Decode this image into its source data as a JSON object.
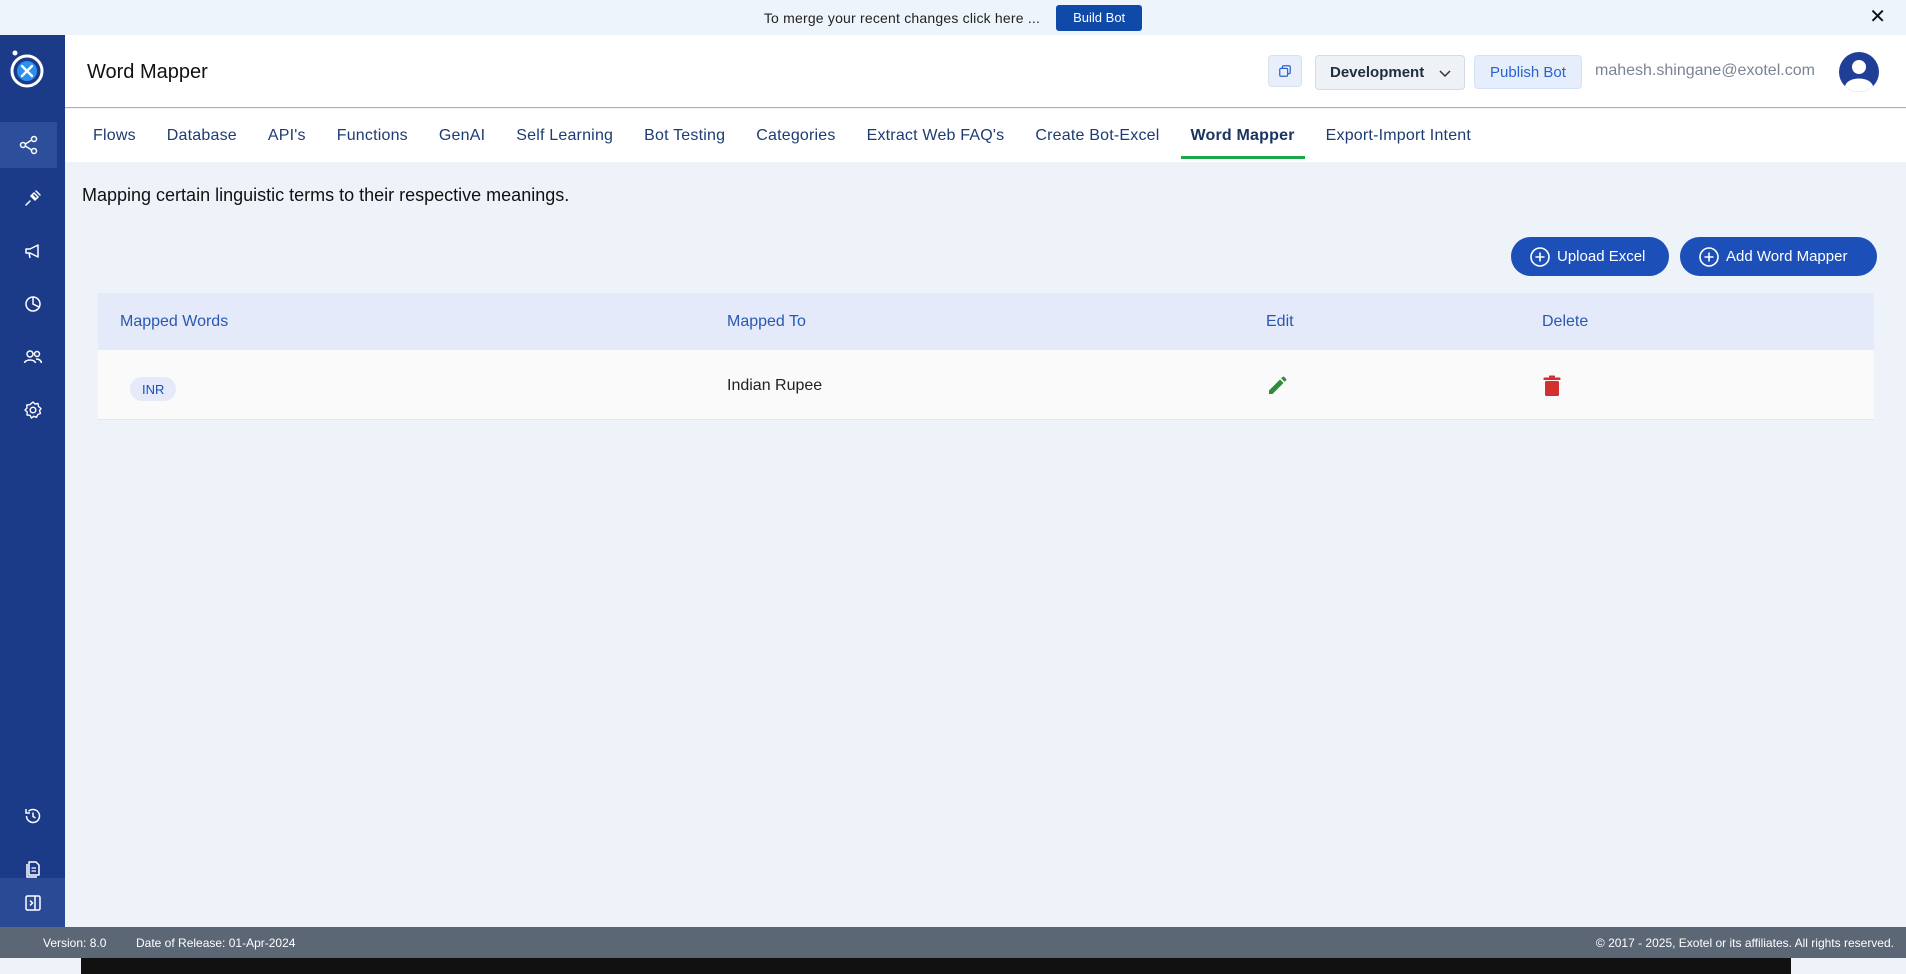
{
  "banner": {
    "message": "To merge your recent changes click here ...",
    "build_label": "Build Bot"
  },
  "sidebar": {
    "items": [
      {
        "icon": "flow-icon"
      },
      {
        "icon": "plug-icon"
      },
      {
        "icon": "megaphone-icon"
      },
      {
        "icon": "analytics-icon"
      },
      {
        "icon": "users-icon"
      },
      {
        "icon": "settings-icon"
      },
      {
        "icon": "history-icon"
      },
      {
        "icon": "documents-icon"
      },
      {
        "icon": "collapse-icon"
      }
    ]
  },
  "header": {
    "title": "Word Mapper",
    "environment": "Development",
    "publish_label": "Publish Bot",
    "user_email": "mahesh.shingane@exotel.com"
  },
  "tabs": [
    {
      "label": "Flows"
    },
    {
      "label": "Database"
    },
    {
      "label": "API's"
    },
    {
      "label": "Functions"
    },
    {
      "label": "GenAI"
    },
    {
      "label": "Self Learning"
    },
    {
      "label": "Bot Testing"
    },
    {
      "label": "Categories"
    },
    {
      "label": "Extract Web FAQ's"
    },
    {
      "label": "Create Bot-Excel"
    },
    {
      "label": "Word Mapper",
      "active": true
    },
    {
      "label": "Export-Import Intent"
    }
  ],
  "main": {
    "description": "Mapping certain linguistic terms to their respective meanings.",
    "upload_label": "Upload Excel",
    "add_label": "Add Word Mapper",
    "table": {
      "headers": [
        "Mapped Words",
        "Mapped To",
        "Edit",
        "Delete"
      ],
      "rows": [
        {
          "word": "INR",
          "mapped_to": "Indian Rupee"
        }
      ]
    }
  },
  "footer": {
    "version": "Version: 8.0",
    "release": "Date of Release: 01-Apr-2024",
    "copyright": "© 2017 - 2025, Exotel or its affiliates. All rights reserved."
  },
  "colors": {
    "sidebar": "#1b3a87",
    "primary": "#1d4fb8",
    "active_tab_underline": "#1ea64a",
    "edit": "#2e8b3a",
    "delete": "#d32f2f"
  }
}
